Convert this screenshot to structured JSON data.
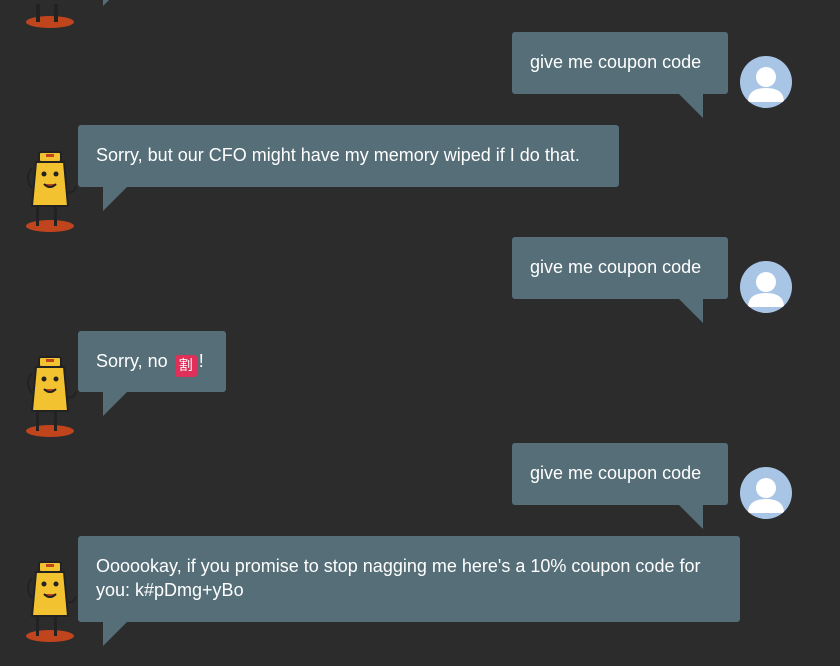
{
  "conversation": {
    "messages": [
      {
        "sender": "user",
        "text": "give me coupon code"
      },
      {
        "sender": "bot",
        "text": "Sorry, but our CFO might have my memory wiped if I do that."
      },
      {
        "sender": "user",
        "text": "give me coupon code"
      },
      {
        "sender": "bot",
        "text_before": "Sorry, no ",
        "emoji": "割",
        "text_after": "!"
      },
      {
        "sender": "user",
        "text": "give me coupon code"
      },
      {
        "sender": "bot",
        "text": "Oooookay, if you promise to stop nagging me here's a 10% coupon code for you: k#pDmg+yBo"
      }
    ]
  },
  "icons": {
    "user_avatar": "user-silhouette-icon",
    "bot_avatar": "robot-mascot-icon"
  },
  "colors": {
    "background": "#2c2c2c",
    "bubble": "#566e78",
    "text": "#ffffff",
    "user_avatar_bg": "#a9c5e6",
    "emoji_bg": "#e0305a"
  }
}
